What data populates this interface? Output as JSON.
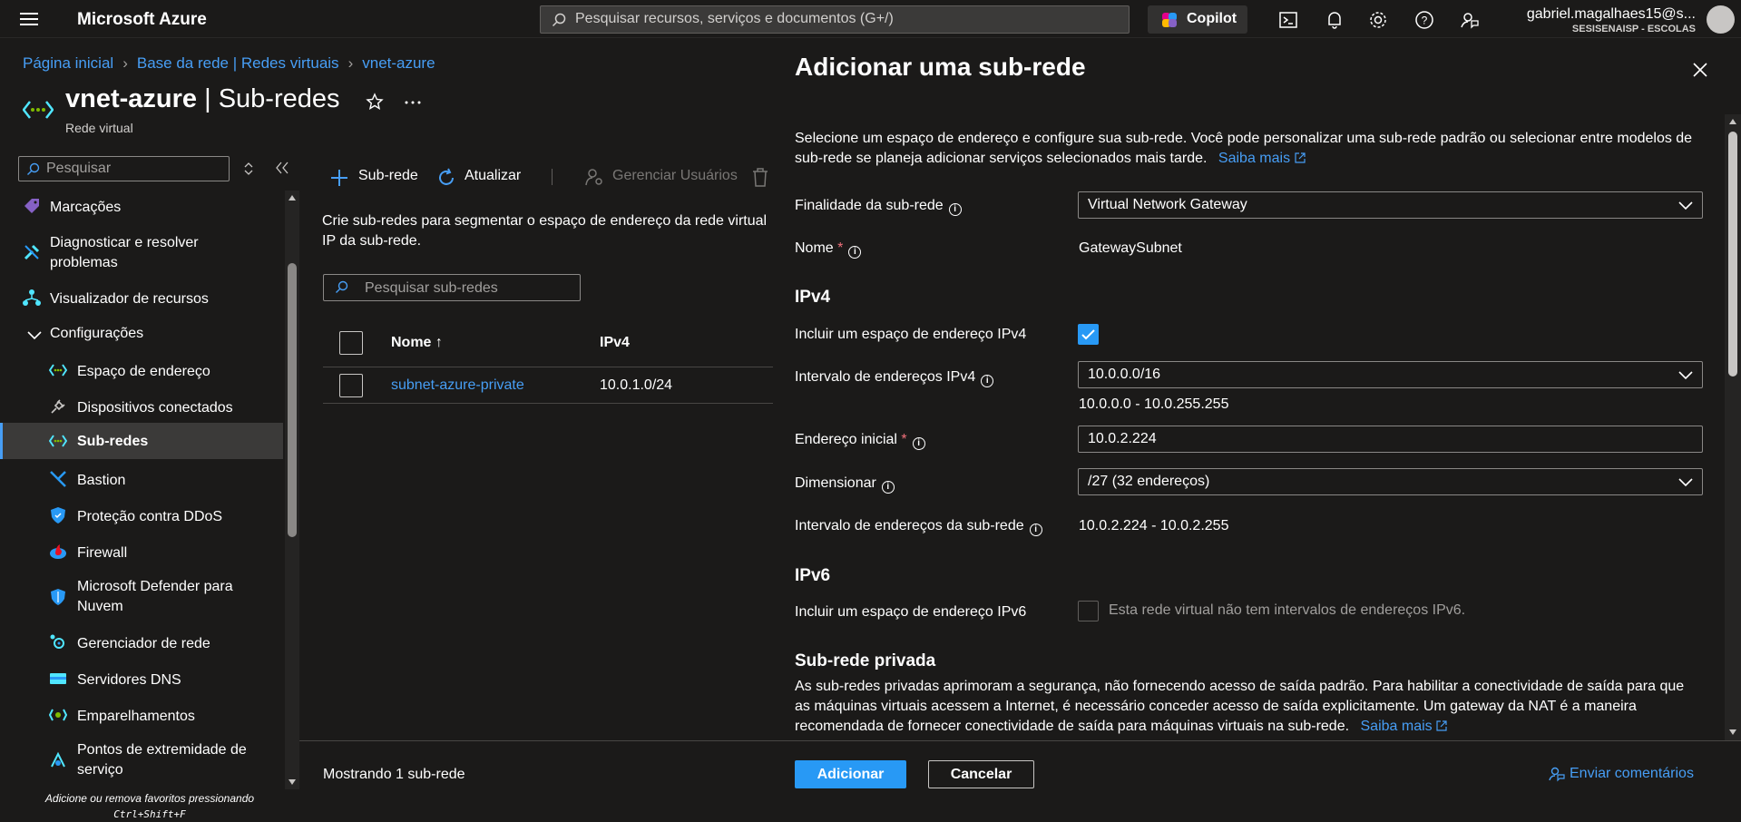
{
  "topbar": {
    "brand": "Microsoft Azure",
    "search_placeholder": "Pesquisar recursos, serviços e documentos (G+/)",
    "copilot_label": "Copilot",
    "user_name": "gabriel.magalhaes15@s...",
    "user_org": "SESISENAISP - ESCOLAS"
  },
  "breadcrumb": {
    "items": [
      "Página inicial",
      "Base da rede | Redes virtuais",
      "vnet-azure"
    ]
  },
  "resource": {
    "name": "vnet-azure",
    "separator": " | ",
    "page": "Sub-redes",
    "type": "Rede virtual"
  },
  "leftnav": {
    "search_placeholder": "Pesquisar",
    "items": [
      {
        "label": "Marcações",
        "icon": "tag-icon"
      },
      {
        "label": "Diagnosticar e resolver problemas",
        "icon": "wrench-icon"
      },
      {
        "label": "Visualizador de recursos",
        "icon": "hierarchy-icon"
      },
      {
        "label": "Configurações",
        "icon": "chevron-down-icon"
      },
      {
        "label": "Espaço de endereço",
        "icon": "vnet-icon"
      },
      {
        "label": "Dispositivos conectados",
        "icon": "plug-icon"
      },
      {
        "label": "Sub-redes",
        "icon": "vnet-icon"
      },
      {
        "label": "Bastion",
        "icon": "bastion-icon"
      },
      {
        "label": "Proteção contra DDoS",
        "icon": "shield-icon"
      },
      {
        "label": "Firewall",
        "icon": "firewall-icon"
      },
      {
        "label": "Microsoft Defender para Nuvem",
        "icon": "defender-shield-icon"
      },
      {
        "label": "Gerenciador de rede",
        "icon": "network-manager-icon"
      },
      {
        "label": "Servidores DNS",
        "icon": "dns-icon"
      },
      {
        "label": "Emparelhamentos",
        "icon": "peering-icon"
      },
      {
        "label": "Pontos de extremidade de serviço",
        "icon": "endpoint-icon"
      }
    ],
    "fav_hint": "Adicione ou remova favoritos pressionando",
    "fav_shortcut": "Ctrl+Shift+F"
  },
  "subnets": {
    "toolbar": {
      "add": "Sub-rede",
      "refresh": "Atualizar",
      "manage_users": "Gerenciar Usuários"
    },
    "description": "Crie sub-redes para segmentar o espaço de endereço da rede virtual IP da sub-rede.",
    "search_placeholder": "Pesquisar sub-redes",
    "columns": [
      "Nome ↑",
      "IPv4"
    ],
    "rows": [
      {
        "name": "subnet-azure-private",
        "ipv4": "10.0.1.0/24"
      }
    ],
    "footer": "Mostrando 1 sub-rede"
  },
  "panel": {
    "title": "Adicionar uma sub-rede",
    "intro": "Selecione um espaço de endereço e configure sua sub-rede. Você pode personalizar uma sub-rede padrão ou selecionar entre modelos de sub-rede se planeja adicionar serviços selecionados mais tarde.",
    "learn_more": "Saiba mais",
    "purpose_label": "Finalidade da sub-rede",
    "purpose_value": "Virtual Network Gateway",
    "name_label": "Nome",
    "name_value": "GatewaySubnet",
    "ipv4_heading": "IPv4",
    "include_ipv4_label": "Incluir um espaço de endereço IPv4",
    "include_ipv4_checked": true,
    "ipv4_range_label": "Intervalo de endereços IPv4",
    "ipv4_range_value": "10.0.0.0/16",
    "ipv4_range_hint": "10.0.0.0 - 10.0.255.255",
    "start_addr_label": "Endereço inicial",
    "start_addr_value": "10.0.2.224",
    "size_label": "Dimensionar",
    "size_value": "/27 (32 endereços)",
    "subnet_range_label": "Intervalo de endereços da sub-rede",
    "subnet_range_value": "10.0.2.224 - 10.0.2.255",
    "ipv6_heading": "IPv6",
    "include_ipv6_label": "Incluir um espaço de endereço IPv6",
    "include_ipv6_checked": false,
    "ipv6_note": "Esta rede virtual não tem intervalos de endereços IPv6.",
    "private_heading": "Sub-rede privada",
    "private_text": "As sub-redes privadas aprimoram a segurança, não fornecendo acesso de saída padrão. Para habilitar a conectividade de saída para que as máquinas virtuais acessem a Internet, é necessário conceder acesso de saída explicitamente. Um gateway da NAT é a maneira recomendada de fornecer conectividade de saída para máquinas virtuais na sub-rede.",
    "private_learn_more": "Saiba mais",
    "add_button": "Adicionar",
    "cancel_button": "Cancelar",
    "feedback": "Enviar comentários"
  },
  "colors": {
    "accent": "#2899f5",
    "link": "#479ef5",
    "background": "#1b1a19",
    "required": "#f1707b"
  }
}
